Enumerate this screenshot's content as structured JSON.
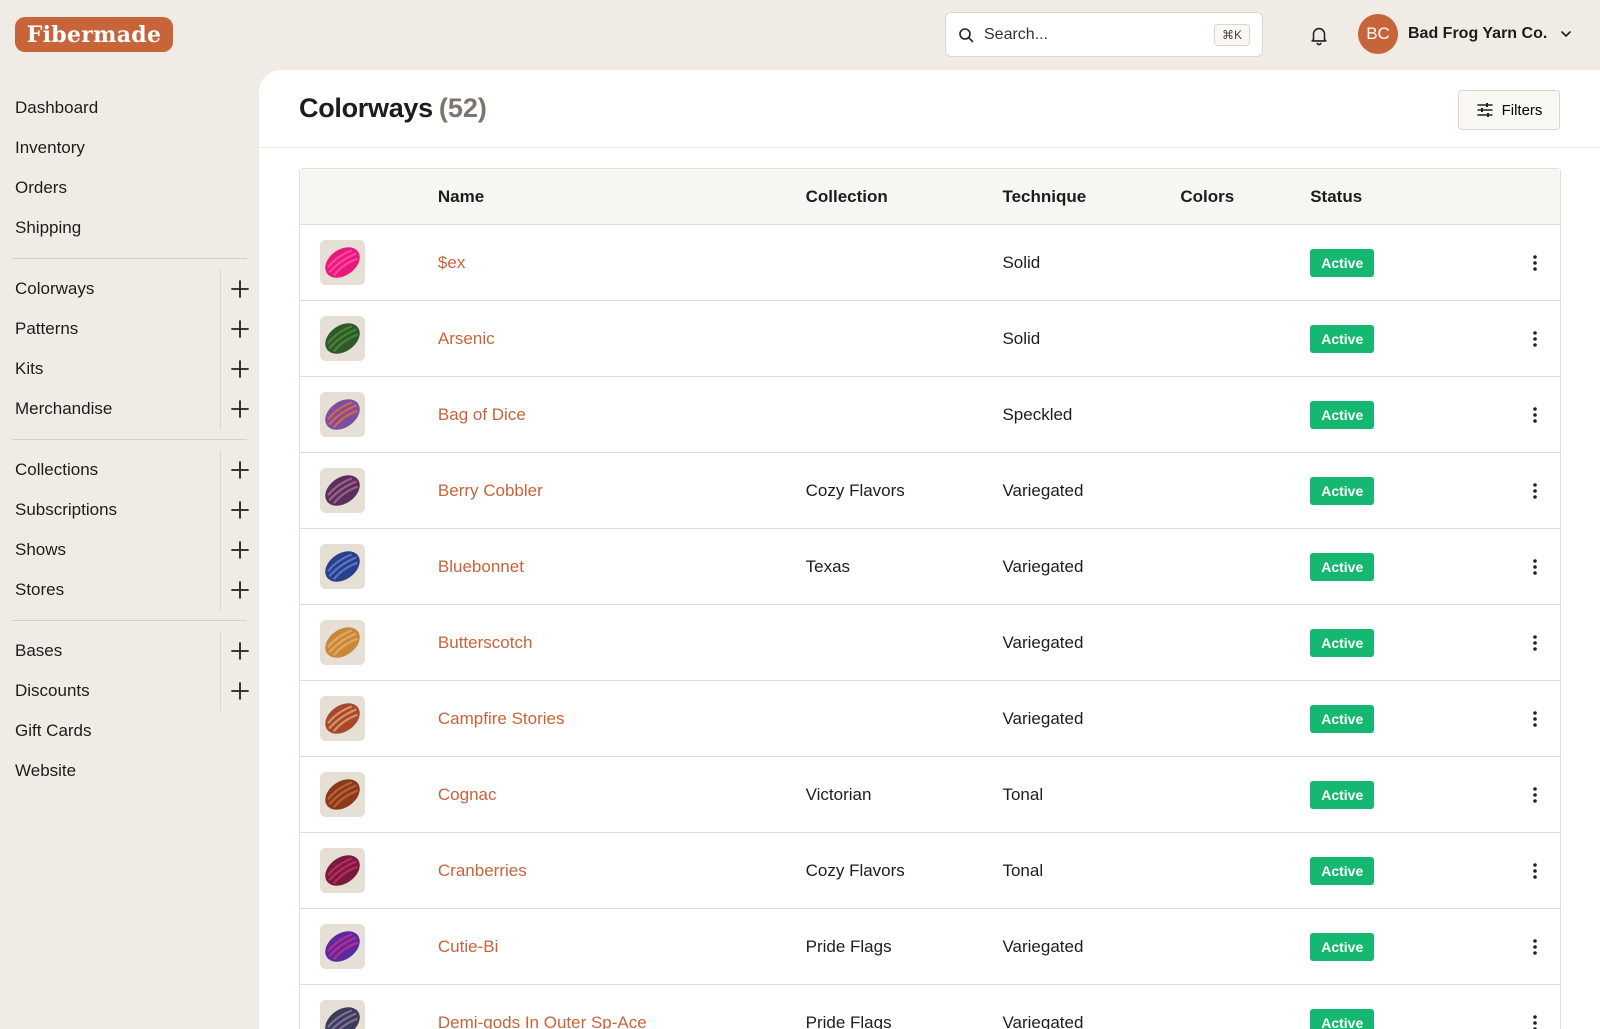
{
  "app": {
    "logo": "Fibermade"
  },
  "search": {
    "placeholder": "Search...",
    "shortcut": "⌘K"
  },
  "account": {
    "initials": "BC",
    "name": "Bad Frog Yarn Co."
  },
  "sidebar": {
    "groups": [
      [
        {
          "label": "Dashboard",
          "add": false
        },
        {
          "label": "Inventory",
          "add": false
        },
        {
          "label": "Orders",
          "add": false
        },
        {
          "label": "Shipping",
          "add": false
        }
      ],
      [
        {
          "label": "Colorways",
          "add": true
        },
        {
          "label": "Patterns",
          "add": true
        },
        {
          "label": "Kits",
          "add": true
        },
        {
          "label": "Merchandise",
          "add": true
        }
      ],
      [
        {
          "label": "Collections",
          "add": true
        },
        {
          "label": "Subscriptions",
          "add": true
        },
        {
          "label": "Shows",
          "add": true
        },
        {
          "label": "Stores",
          "add": true
        }
      ],
      [
        {
          "label": "Bases",
          "add": true
        },
        {
          "label": "Discounts",
          "add": true
        },
        {
          "label": "Gift Cards",
          "add": false
        },
        {
          "label": "Website",
          "add": false
        }
      ]
    ]
  },
  "page": {
    "title": "Colorways",
    "count": "(52)",
    "filters_label": "Filters"
  },
  "table": {
    "headers": [
      "Name",
      "Collection",
      "Technique",
      "Colors",
      "Status"
    ],
    "rows": [
      {
        "name": "$ex",
        "collection": "",
        "technique": "Solid",
        "colors": "",
        "status": "Active",
        "swatch": [
          "#e8197a",
          "#ff4fa6"
        ]
      },
      {
        "name": "Arsenic",
        "collection": "",
        "technique": "Solid",
        "colors": "",
        "status": "Active",
        "swatch": [
          "#2e5a2a",
          "#4f8a3c"
        ]
      },
      {
        "name": "Bag of Dice",
        "collection": "",
        "technique": "Speckled",
        "colors": "",
        "status": "Active",
        "swatch": [
          "#7a4fa0",
          "#e86a3a"
        ]
      },
      {
        "name": "Berry Cobbler",
        "collection": "Cozy Flavors",
        "technique": "Variegated",
        "colors": "",
        "status": "Active",
        "swatch": [
          "#5a2f5e",
          "#a86a8a"
        ]
      },
      {
        "name": "Bluebonnet",
        "collection": "Texas",
        "technique": "Variegated",
        "colors": "",
        "status": "Active",
        "swatch": [
          "#2a3f8a",
          "#5e7fd0"
        ]
      },
      {
        "name": "Butterscotch",
        "collection": "",
        "technique": "Variegated",
        "colors": "",
        "status": "Active",
        "swatch": [
          "#c9873a",
          "#e8b068"
        ]
      },
      {
        "name": "Campfire Stories",
        "collection": "",
        "technique": "Variegated",
        "colors": "",
        "status": "Active",
        "swatch": [
          "#a8482a",
          "#e0a070"
        ]
      },
      {
        "name": "Cognac",
        "collection": "Victorian",
        "technique": "Tonal",
        "colors": "",
        "status": "Active",
        "swatch": [
          "#8a3a1a",
          "#c06a3a"
        ]
      },
      {
        "name": "Cranberries",
        "collection": "Cozy Flavors",
        "technique": "Tonal",
        "colors": "",
        "status": "Active",
        "swatch": [
          "#7a1a3a",
          "#c0306a"
        ]
      },
      {
        "name": "Cutie-Bi",
        "collection": "Pride Flags",
        "technique": "Variegated",
        "colors": "",
        "status": "Active",
        "swatch": [
          "#5a2aa0",
          "#d02a8a"
        ]
      },
      {
        "name": "Demi-gods In Outer Sp-Ace",
        "collection": "Pride Flags",
        "technique": "Variegated",
        "colors": "",
        "status": "Active",
        "swatch": [
          "#3a3a5a",
          "#8a7a9a"
        ]
      }
    ]
  },
  "colors": {
    "accent": "#c8643a",
    "status_active": "#16b871",
    "background": "#f0ebe4"
  }
}
